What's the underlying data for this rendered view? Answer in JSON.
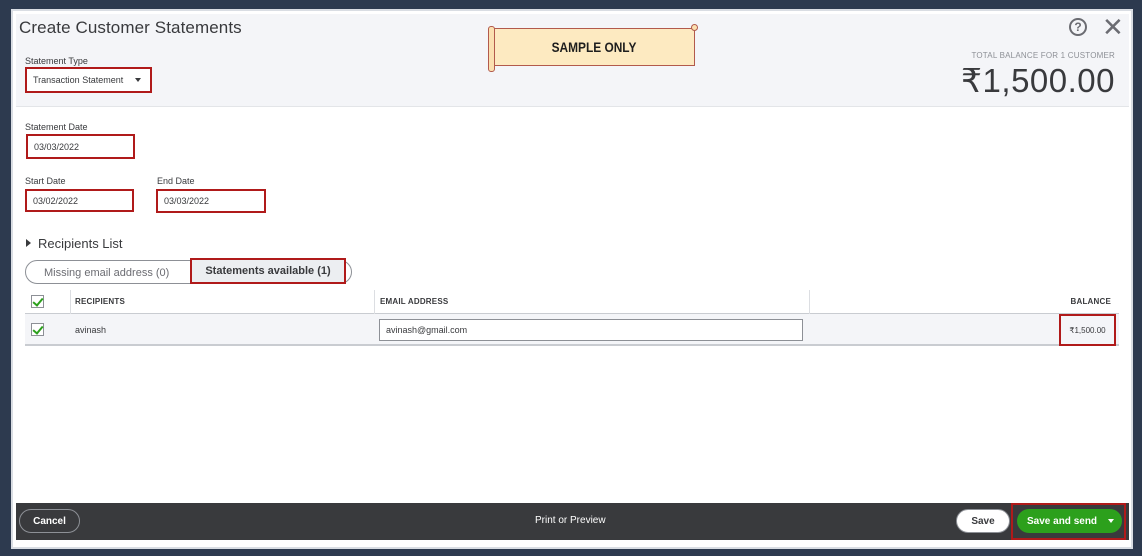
{
  "dialog": {
    "title": "Create Customer Statements",
    "help_symbol": "?",
    "close_symbol": "✕"
  },
  "stamp": {
    "text": "SAMPLE ONLY"
  },
  "statement_type": {
    "label": "Statement Type",
    "value": "Transaction Statement"
  },
  "statement_date": {
    "label": "Statement Date",
    "value": "03/03/2022"
  },
  "start_date": {
    "label": "Start Date",
    "value": "03/02/2022"
  },
  "end_date": {
    "label": "End Date",
    "value": "03/03/2022"
  },
  "balance": {
    "caption": "TOTAL BALANCE FOR 1 CUSTOMER",
    "amount": "₹1,500.00"
  },
  "recipients": {
    "section_label": "Recipients List",
    "tabs": [
      "Missing email address (0)",
      "Statements available (1)"
    ],
    "columns": [
      "RECIPIENTS",
      "EMAIL ADDRESS",
      "BALANCE"
    ],
    "rows": [
      {
        "name": "avinash",
        "email": "avinash@gmail.com",
        "balance": "₹1,500.00",
        "checked": true
      }
    ]
  },
  "footer": {
    "cancel_label": "Cancel",
    "print_label": "Print or Preview",
    "save_label": "Save",
    "save_send_label": "Save and send"
  },
  "colors": {
    "accent": "#2ca01c",
    "highlight": "#b01a1a",
    "footer": "#393a3d"
  }
}
